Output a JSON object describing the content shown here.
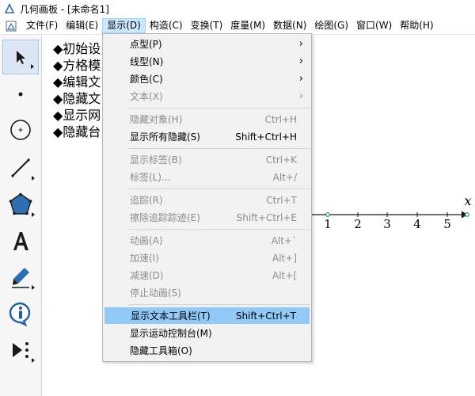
{
  "window": {
    "title": "几何画板 - [未命名1]"
  },
  "menubar": {
    "items": [
      "文件(F)",
      "编辑(E)",
      "显示(D)",
      "构造(C)",
      "变换(T)",
      "度量(M)",
      "数据(N)",
      "绘图(G)",
      "窗口(W)",
      "帮助(H)"
    ],
    "active_index": 2
  },
  "toolbox": {
    "tools": [
      "arrow-select-tool",
      "point-tool",
      "compass-tool",
      "line-tool",
      "polygon-tool",
      "text-tool",
      "marker-tool",
      "information-tool",
      "custom-tool"
    ],
    "selected": "arrow-select-tool"
  },
  "canvas": {
    "bullet_lines": [
      "◆初始设",
      "◆方格模",
      "◆编辑文",
      "◆隐藏文",
      "◆显示网",
      "◆隐藏台"
    ],
    "axis": {
      "label": "x",
      "ticks": [
        "1",
        "2",
        "3",
        "4",
        "5"
      ]
    }
  },
  "dropdown": {
    "groups": [
      [
        {
          "label": "点型(P)",
          "shortcut": "",
          "submenu": true,
          "disabled": false
        },
        {
          "label": "线型(N)",
          "shortcut": "",
          "submenu": true,
          "disabled": false
        },
        {
          "label": "颜色(C)",
          "shortcut": "",
          "submenu": true,
          "disabled": false
        },
        {
          "label": "文本(X)",
          "shortcut": "",
          "submenu": true,
          "disabled": true
        }
      ],
      [
        {
          "label": "隐藏对象(H)",
          "shortcut": "Ctrl+H",
          "submenu": false,
          "disabled": true
        },
        {
          "label": "显示所有隐藏(S)",
          "shortcut": "Shift+Ctrl+H",
          "submenu": false,
          "disabled": false
        }
      ],
      [
        {
          "label": "显示标签(B)",
          "shortcut": "Ctrl+K",
          "submenu": false,
          "disabled": true
        },
        {
          "label": "标签(L)...",
          "shortcut": "Alt+/",
          "submenu": false,
          "disabled": true
        }
      ],
      [
        {
          "label": "追踪(R)",
          "shortcut": "Ctrl+T",
          "submenu": false,
          "disabled": true
        },
        {
          "label": "擦除追踪踪迹(E)",
          "shortcut": "Shift+Ctrl+E",
          "submenu": false,
          "disabled": true
        }
      ],
      [
        {
          "label": "动画(A)",
          "shortcut": "Alt+`",
          "submenu": false,
          "disabled": true
        },
        {
          "label": "加速(I)",
          "shortcut": "Alt+]",
          "submenu": false,
          "disabled": true
        },
        {
          "label": "减速(D)",
          "shortcut": "Alt+[",
          "submenu": false,
          "disabled": true
        },
        {
          "label": "停止动画(S)",
          "shortcut": "",
          "submenu": false,
          "disabled": true
        }
      ],
      [
        {
          "label": "显示文本工具栏(T)",
          "shortcut": "Shift+Ctrl+T",
          "submenu": false,
          "disabled": false,
          "highlighted": true
        },
        {
          "label": "显示运动控制台(M)",
          "shortcut": "",
          "submenu": false,
          "disabled": false
        },
        {
          "label": "隐藏工具箱(O)",
          "shortcut": "",
          "submenu": false,
          "disabled": false
        }
      ]
    ]
  },
  "colors": {
    "menu_highlight": "#91c9f7",
    "menubar_active": "#cce8ff",
    "disabled_text": "#8c8c8c",
    "polygon_tool": "#2d6fb5",
    "info_tool": "#1f5fa6"
  }
}
